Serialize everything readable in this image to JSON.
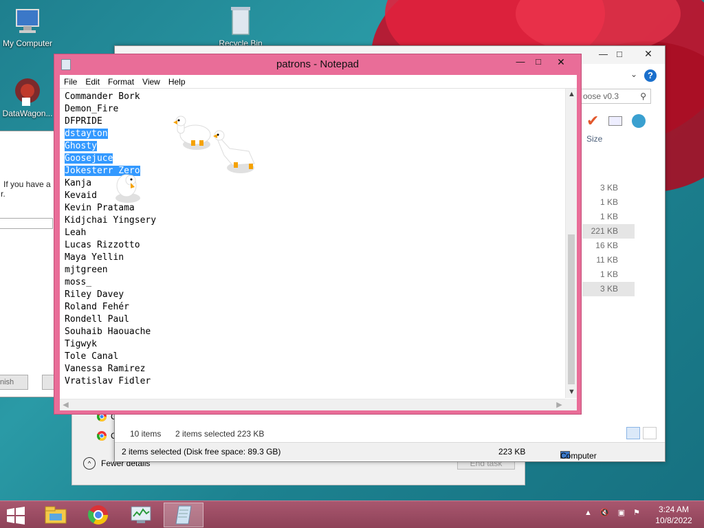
{
  "desktop": {
    "icons": [
      {
        "label": "My Computer"
      },
      {
        "label": "Recycle Bin"
      },
      {
        "label": "DataWagon..."
      }
    ]
  },
  "background_dialog": {
    "text_line1": "If you have a",
    "text_line2": "r.",
    "finish_label": "nish"
  },
  "task_manager": {
    "fewer_details": "Fewer details",
    "end_task": "End task",
    "app_letter": "C"
  },
  "explorer": {
    "search_placeholder": "oose v0.3",
    "size_header": "Size",
    "sizes": [
      "3 KB",
      "1 KB",
      "1 KB",
      "221 KB",
      "16 KB",
      "11 KB",
      "1 KB",
      "3 KB"
    ],
    "status_items": "10 items",
    "status_selected": "2 items selected  223 KB",
    "bottom_status": "2 items selected (Disk free space: 89.3 GB)",
    "bottom_size": "223 KB",
    "bottom_location": "Computer"
  },
  "notepad": {
    "title": "patrons - Notepad",
    "menu": [
      "File",
      "Edit",
      "Format",
      "View",
      "Help"
    ],
    "lines": [
      {
        "text": "Commander Bork",
        "selected": false
      },
      {
        "text": "Demon_Fire",
        "selected": false
      },
      {
        "text": "DFPRIDE",
        "selected": false
      },
      {
        "text": "dstayton",
        "selected": true
      },
      {
        "text": "Ghosty",
        "selected": true
      },
      {
        "text": "Goosejuce",
        "selected": true
      },
      {
        "text": "Jokesterr Zero",
        "selected": true
      },
      {
        "text": "Kanja",
        "selected": false
      },
      {
        "text": "Kevaid",
        "selected": false
      },
      {
        "text": "Kevin Pratama",
        "selected": false
      },
      {
        "text": "Kidjchai Yingsery",
        "selected": false
      },
      {
        "text": "Leah",
        "selected": false
      },
      {
        "text": "Lucas Rizzotto",
        "selected": false
      },
      {
        "text": "Maya Yellin",
        "selected": false
      },
      {
        "text": "mjtgreen",
        "selected": false
      },
      {
        "text": "moss_",
        "selected": false
      },
      {
        "text": "Riley Davey",
        "selected": false
      },
      {
        "text": "Roland Fehér",
        "selected": false
      },
      {
        "text": "Rondell Paul",
        "selected": false
      },
      {
        "text": "Souhaib Haouache",
        "selected": false
      },
      {
        "text": "Tigwyk",
        "selected": false
      },
      {
        "text": "Tole Canal",
        "selected": false
      },
      {
        "text": "Vanessa Ramirez",
        "selected": false
      },
      {
        "text": "Vratislav Fidler",
        "selected": false
      }
    ],
    "selection_color": "#3399ff",
    "frame_color": "#e96d98"
  },
  "taskbar": {
    "items": [
      "file-explorer-icon",
      "chrome-icon",
      "task-manager-icon",
      "notepad-icon"
    ],
    "time": "3:24 AM",
    "date": "10/8/2022",
    "color": "#a9576f"
  }
}
